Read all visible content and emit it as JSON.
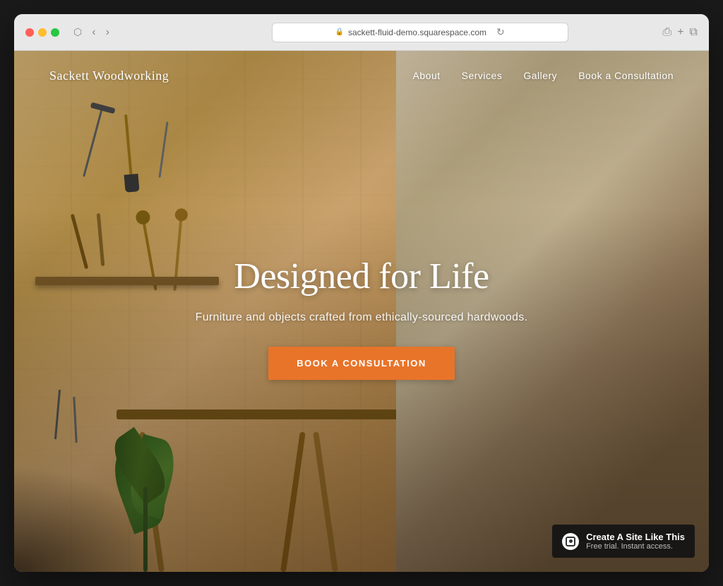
{
  "browser": {
    "url": "sackett-fluid-demo.squarespace.com",
    "back_label": "←",
    "forward_label": "→",
    "reload_label": "↻"
  },
  "nav": {
    "logo": "Sackett Woodworking",
    "links": [
      {
        "label": "About",
        "id": "about"
      },
      {
        "label": "Services",
        "id": "services"
      },
      {
        "label": "Gallery",
        "id": "gallery"
      },
      {
        "label": "Book a Consultation",
        "id": "book-consultation"
      }
    ]
  },
  "hero": {
    "title": "Designed for Life",
    "subtitle": "Furniture and objects crafted from ethically-sourced hardwoods.",
    "cta_button": "Book a Consultation"
  },
  "squarespace_badge": {
    "title": "Create A Site Like This",
    "subtitle": "Free trial. Instant access."
  }
}
